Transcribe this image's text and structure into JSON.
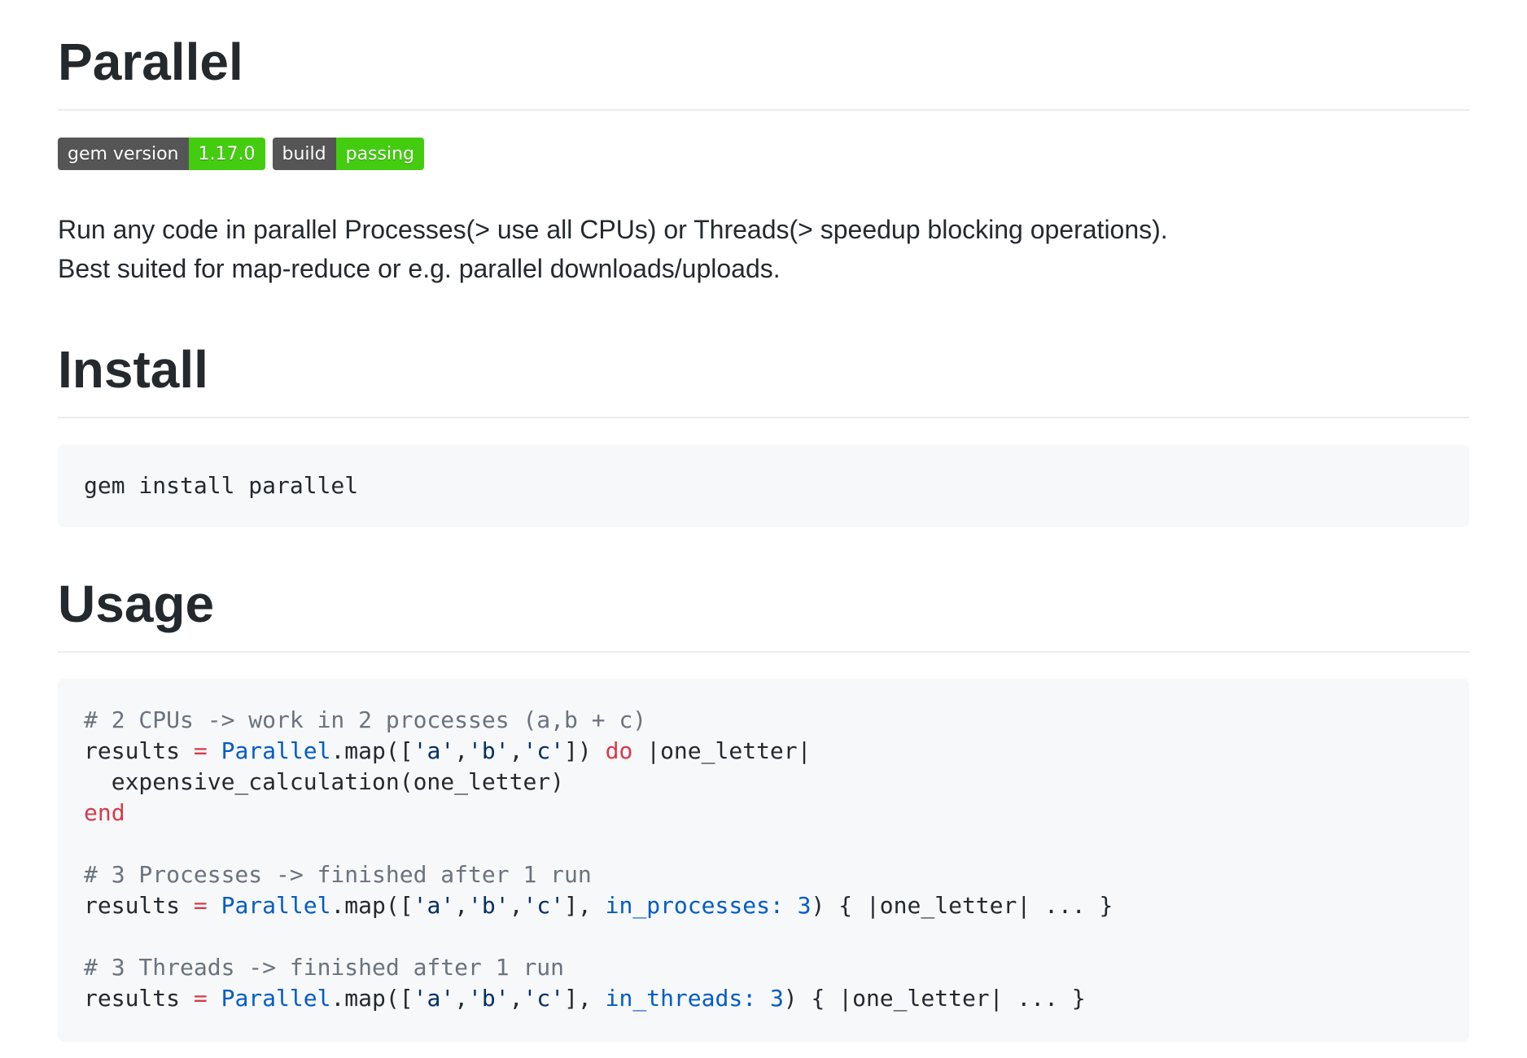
{
  "title": "Parallel",
  "badges": [
    {
      "label": "gem version",
      "value": "1.17.0"
    },
    {
      "label": "build",
      "value": "passing"
    }
  ],
  "colors": {
    "badge_label_bg": "#555555",
    "badge_value_bg": "#4c1",
    "code_bg": "#f6f8fa",
    "keyword": "#d73a49",
    "constant": "#005cc5",
    "string": "#032f62",
    "comment": "#6a737d"
  },
  "description": [
    "Run any code in parallel Processes(> use all CPUs) or Threads(> speedup blocking operations).",
    "Best suited for map-reduce or e.g. parallel downloads/uploads."
  ],
  "install": {
    "heading": "Install",
    "code": "gem install parallel"
  },
  "usage": {
    "heading": "Usage",
    "comment1": "# 2 CPUs -> work in 2 processes (a,b + c)",
    "results": "results",
    "eq": " = ",
    "parallel": "Parallel",
    "map_open": ".map([",
    "a": "'a'",
    "b": "'b'",
    "c": "'c'",
    "comma": ",",
    "close1": "]) ",
    "do": "do",
    "block_arg": " |one_letter|",
    "body": "  expensive_calculation(one_letter)",
    "end": "end",
    "comment2": "# 3 Processes -> finished after 1 run",
    "close2": "], ",
    "in_processes": "in_processes:",
    "space": " ",
    "three": "3",
    "tail": ") { |one_letter| ... }",
    "comment3": "# 3 Threads -> finished after 1 run",
    "in_threads": "in_threads:"
  }
}
